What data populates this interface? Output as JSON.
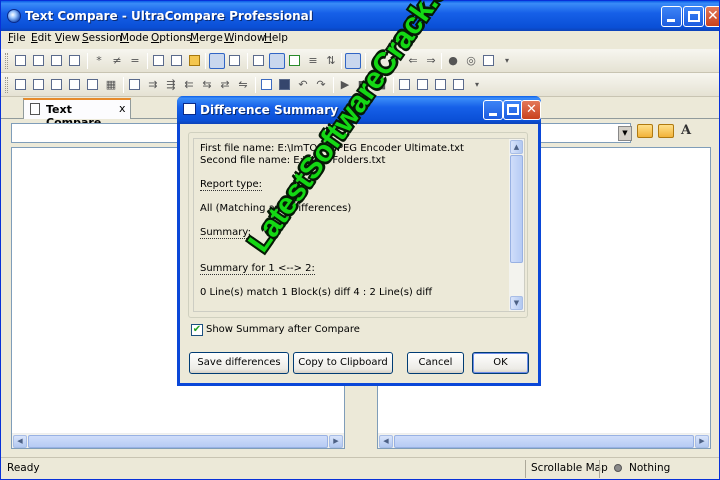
{
  "window": {
    "title": "Text Compare - UltraCompare Professional"
  },
  "menu": [
    "File",
    "Edit",
    "View",
    "Session",
    "Mode",
    "Options",
    "Merge",
    "Window",
    "Help"
  ],
  "toolbar1_icons": [
    "new-session-icon",
    "open-icon",
    "print-icon",
    "print-preview-icon",
    "mark-icon",
    "not-equal-icon",
    "equal-icon",
    "copy-icon",
    "binary-icon",
    "folder-icon",
    "side-by-side-icon",
    "over-under-icon",
    "sync-icon",
    "merge-view-icon",
    "diff-list-icon",
    "swap-icon",
    "report-icon",
    "down-arrow-icon",
    "up-arrow-icon",
    "left-arrow-icon",
    "right-arrow-icon",
    "globe-icon",
    "ftp-icon"
  ],
  "toolbar2_icons": [
    "first-diff-icon",
    "prev-diff-icon",
    "next-diff-icon",
    "last-diff-icon",
    "block-icon",
    "table-icon",
    "merge-left-icon",
    "merge-right-icon",
    "merge-all-left-icon",
    "merge-all-right-icon",
    "sync-scroll-icon",
    "save-icon",
    "undo-icon",
    "redo-icon",
    "run-icon",
    "stop-icon",
    "pause-icon",
    "compare-1-icon",
    "compare-2-icon",
    "compare-3-icon",
    "ignore-icon"
  ],
  "tab": {
    "label": "Text Compare",
    "close": "x"
  },
  "statusbar": {
    "ready": "Ready",
    "map": "Scrollable Map",
    "status": "Nothing"
  },
  "dialog": {
    "title": "Difference Summary",
    "close_glyph": "✕",
    "report_lines": {
      "first_file": "First file name: E:\\ImTOO MPEG Encoder Ultimate.txt",
      "second_file": "Second file name: E:\\Hide Folders.txt",
      "report_type_label": "Report type:",
      "report_type_value": "All (Matching and Differences)",
      "summary_label": "Summary:",
      "summary_for": "Summary for 1 <--> 2:",
      "summary_value": "0 Line(s) match  1 Block(s) diff  4 : 2 Line(s) diff"
    },
    "checkbox_label": "Show Summary after Compare",
    "checkbox_checked": true,
    "buttons": {
      "save": "Save differences",
      "copy": "Copy to Clipboard",
      "cancel": "Cancel",
      "ok": "OK"
    }
  },
  "watermark": "LatestSoftwareCrack.com",
  "colors": {
    "title_blue": "#0a4fd6",
    "watermark_green": "#14d814",
    "close_red": "#c9411c"
  }
}
